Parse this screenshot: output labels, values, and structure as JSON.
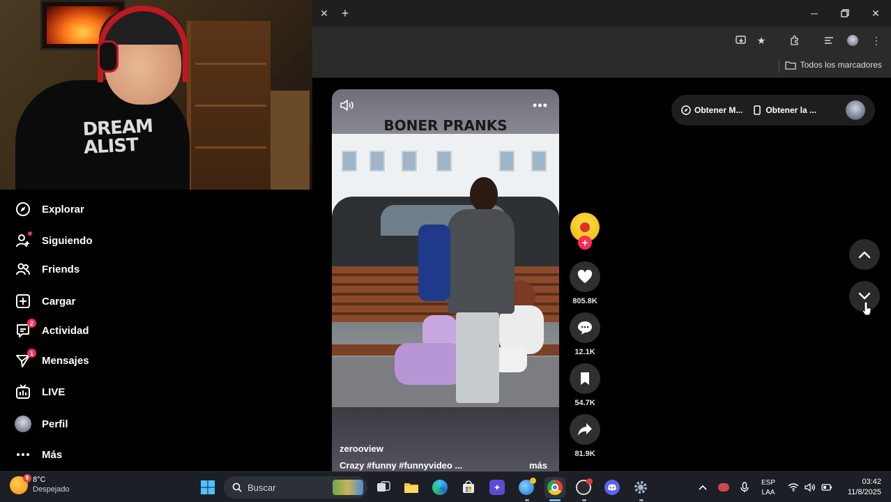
{
  "sidebar": {
    "items": [
      {
        "label": "Explorar",
        "icon": "compass-icon"
      },
      {
        "label": "Siguiendo",
        "icon": "following-icon"
      },
      {
        "label": "Friends",
        "icon": "friends-icon"
      },
      {
        "label": "Cargar",
        "icon": "upload-icon"
      },
      {
        "label": "Actividad",
        "icon": "activity-icon",
        "badge": "2"
      },
      {
        "label": "Mensajes",
        "icon": "messages-icon",
        "badge": "1"
      },
      {
        "label": "LIVE",
        "icon": "live-icon"
      },
      {
        "label": "Perfil",
        "icon": "profile-avatar"
      },
      {
        "label": "Más",
        "icon": "more-icon"
      }
    ]
  },
  "browser": {
    "bookmarks_all": "Todos los marcadores"
  },
  "video": {
    "overlay_title": "BONER PRANKS",
    "username": "zerooview",
    "caption": "Crazy #funny  #funnyvideo ...",
    "more_label": "más"
  },
  "actions": {
    "likes": "805.8K",
    "comments": "12.1K",
    "saves": "54.7K",
    "shares": "81.9K"
  },
  "get_bar": {
    "item1": "Obtener M...",
    "item2": "Obtener la ..."
  },
  "taskbar": {
    "temperature": "8°C",
    "condition": "Despejado",
    "weather_badge": "9",
    "search_label": "Buscar",
    "lang_line1": "ESP",
    "lang_line2": "LAA",
    "time": "03:42",
    "date": "11/8/2025"
  },
  "colors": {
    "accent": "#fe2c55",
    "background": "#000000",
    "taskbar": "#1c1f26"
  }
}
